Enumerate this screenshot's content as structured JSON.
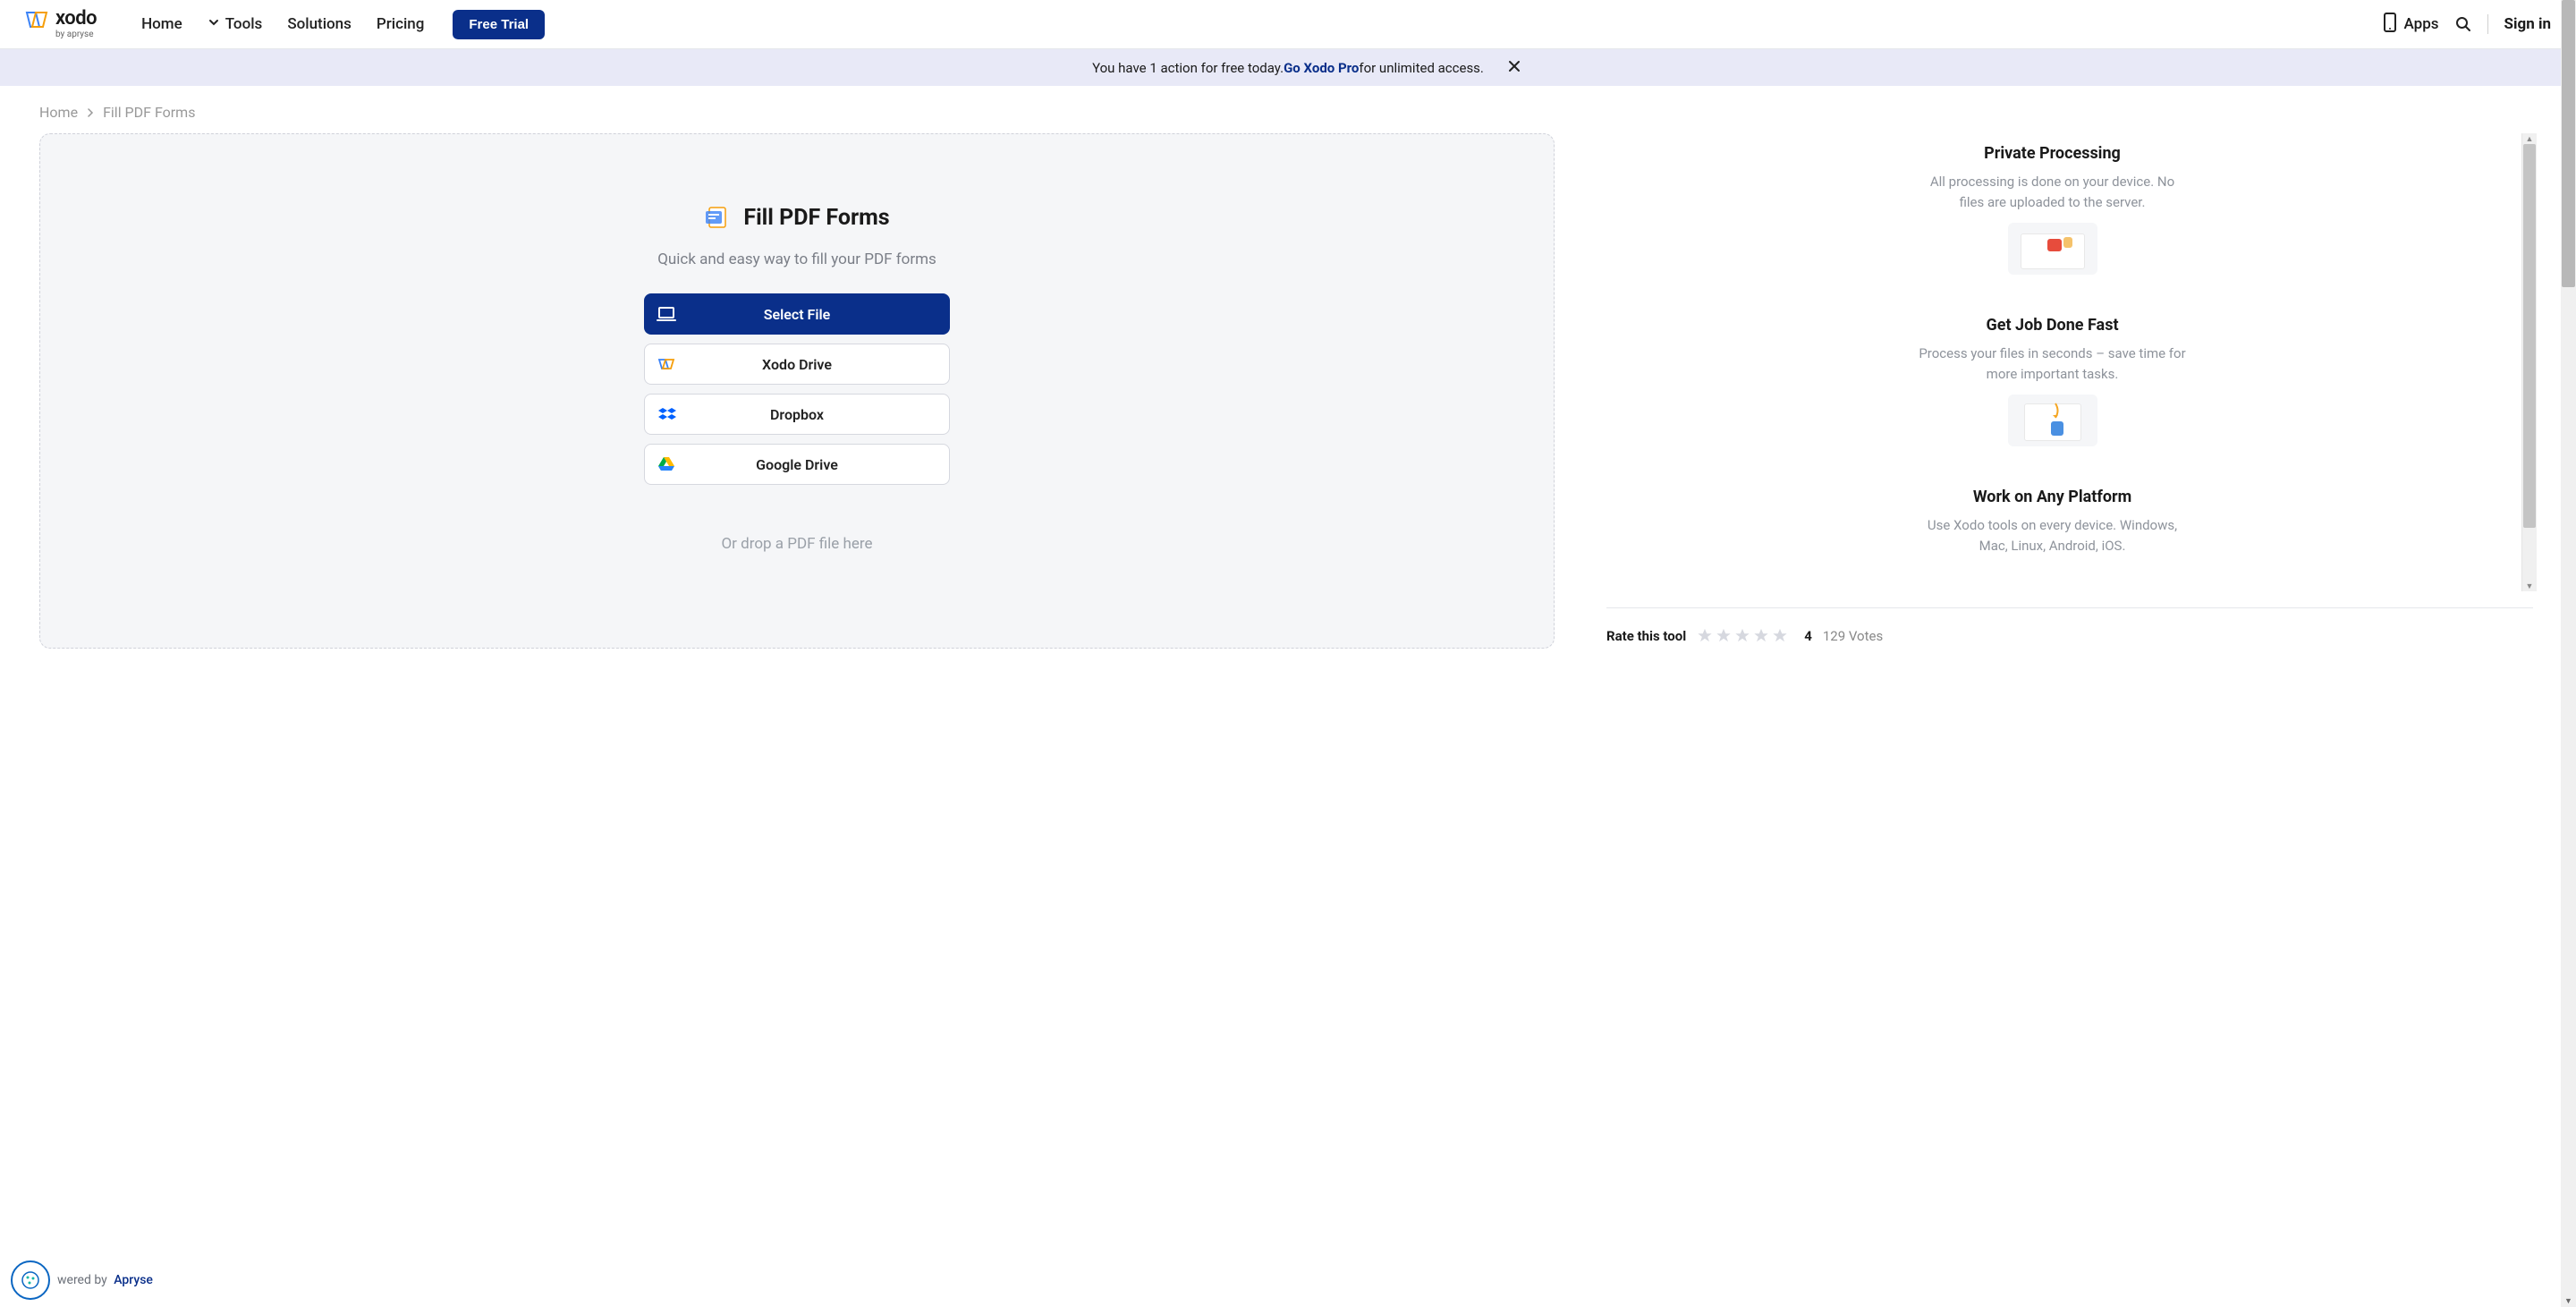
{
  "header": {
    "logo_name": "xodo",
    "logo_sub": "by apryse",
    "nav": {
      "home": "Home",
      "tools": "Tools",
      "solutions": "Solutions",
      "pricing": "Pricing",
      "free_trial": "Free Trial"
    },
    "apps": "Apps",
    "signin": "Sign in"
  },
  "banner": {
    "text_before": "You have 1 action for free today. ",
    "cta": "Go Xodo Pro",
    "text_after": " for unlimited access."
  },
  "breadcrumb": {
    "home": "Home",
    "current": "Fill PDF Forms"
  },
  "tool": {
    "title": "Fill PDF Forms",
    "subtitle": "Quick and easy way to fill your PDF forms",
    "select_file": "Select File",
    "xodo_drive": "Xodo Drive",
    "dropbox": "Dropbox",
    "google_drive": "Google Drive",
    "drop_hint": "Or drop a PDF file here"
  },
  "features": [
    {
      "title": "Private Processing",
      "desc": "All processing is done on your device. No files are uploaded to the server."
    },
    {
      "title": "Get Job Done Fast",
      "desc": "Process your files in seconds – save time for more important tasks."
    },
    {
      "title": "Work on Any Platform",
      "desc": "Use Xodo tools on every device. Windows, Mac, Linux, Android, iOS."
    }
  ],
  "rating": {
    "label": "Rate this tool",
    "score": "4",
    "votes": "129 Votes"
  },
  "footer": {
    "powered": "wered by",
    "brand": "Apryse"
  }
}
